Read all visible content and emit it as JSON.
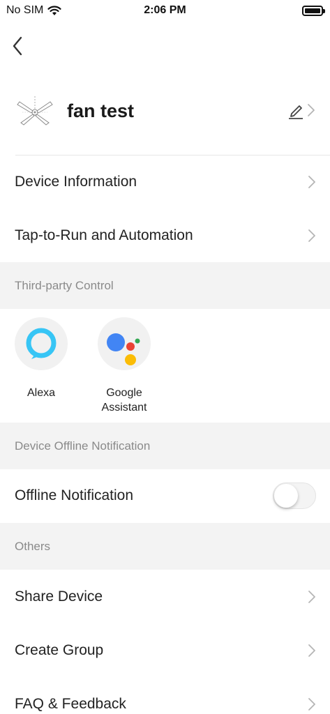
{
  "status": {
    "carrier": "No SIM",
    "time": "2:06 PM"
  },
  "device": {
    "name": "fan test"
  },
  "rows": {
    "device_information": "Device Information",
    "tap_to_run": "Tap-to-Run and Automation",
    "offline_notification": "Offline Notification",
    "share_device": "Share Device",
    "create_group": "Create Group",
    "faq_feedback": "FAQ & Feedback"
  },
  "sections": {
    "third_party": "Third-party Control",
    "offline": "Device Offline Notification",
    "others": "Others"
  },
  "third_party": {
    "alexa_label": "Alexa",
    "google_label_line1": "Google",
    "google_label_line2": "Assistant"
  },
  "offline_notification_enabled": false,
  "colors": {
    "section_bg": "#f3f3f3",
    "alexa_blue": "#37c5f5",
    "google_blue": "#4285f4",
    "google_red": "#ea4335",
    "google_yellow": "#fbbc05",
    "google_green": "#34a853"
  }
}
